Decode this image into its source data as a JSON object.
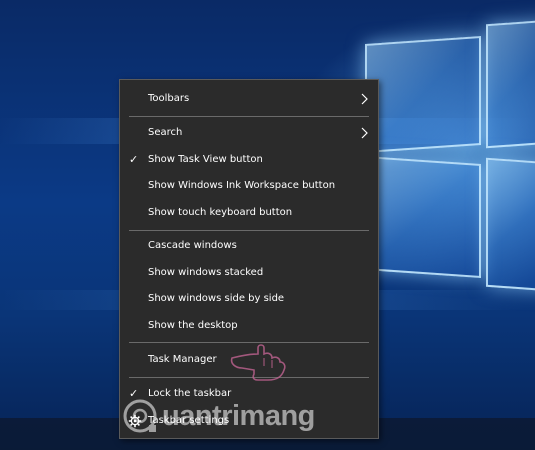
{
  "menu": {
    "items": [
      {
        "label": "Toolbars",
        "checked": false,
        "submenu": true
      },
      {
        "label": "Search",
        "checked": false,
        "submenu": true
      },
      {
        "label": "Show Task View button",
        "checked": true,
        "submenu": false
      },
      {
        "label": "Show Windows Ink Workspace button",
        "checked": false,
        "submenu": false
      },
      {
        "label": "Show touch keyboard button",
        "checked": false,
        "submenu": false
      },
      {
        "label": "Cascade windows",
        "checked": false,
        "submenu": false
      },
      {
        "label": "Show windows stacked",
        "checked": false,
        "submenu": false
      },
      {
        "label": "Show windows side by side",
        "checked": false,
        "submenu": false
      },
      {
        "label": "Show the desktop",
        "checked": false,
        "submenu": false
      },
      {
        "label": "Task Manager",
        "checked": false,
        "submenu": false
      },
      {
        "label": "Lock the taskbar",
        "checked": true,
        "submenu": false
      },
      {
        "label": "Taskbar settings",
        "checked": false,
        "submenu": false,
        "icon": "gear-icon"
      }
    ],
    "check_glyph": "✓",
    "colors": {
      "background": "#2b2b2b",
      "text": "#ffffff",
      "separator": "#6a6a6a"
    }
  },
  "watermark": {
    "text": "uantrimang"
  }
}
